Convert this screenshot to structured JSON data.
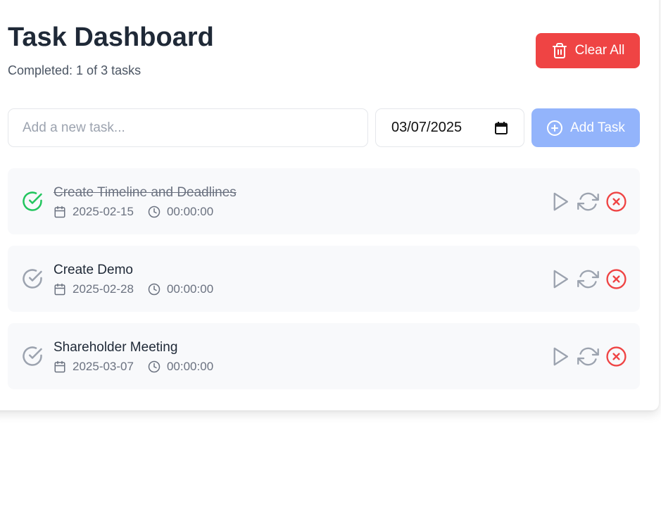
{
  "header": {
    "title": "Task Dashboard",
    "completed_text": "Completed: 1 of 3 tasks",
    "clear_all_label": "Clear All"
  },
  "form": {
    "task_placeholder": "Add a new task...",
    "task_value": "",
    "date_value": "03/07/2025",
    "add_label": "Add Task"
  },
  "tasks": [
    {
      "title": "Create Timeline and Deadlines",
      "date": "2025-02-15",
      "time": "00:00:00",
      "completed": true
    },
    {
      "title": "Create Demo",
      "date": "2025-02-28",
      "time": "00:00:00",
      "completed": false
    },
    {
      "title": "Shareholder Meeting",
      "date": "2025-03-07",
      "time": "00:00:00",
      "completed": false
    }
  ],
  "colors": {
    "danger": "#ef4444",
    "primary_disabled": "#93b4fb",
    "success": "#22c55e",
    "muted": "#9ca3af",
    "row_bg": "#f8f9fb"
  },
  "icons": {
    "clear_all": "trash-icon",
    "add_task": "plus-circle-icon",
    "date_picker": "calendar-icon",
    "task_check": "check-circle-icon",
    "task_date": "calendar-icon",
    "task_time": "clock-icon",
    "start": "play-icon",
    "reset": "refresh-icon",
    "delete": "x-circle-icon"
  }
}
